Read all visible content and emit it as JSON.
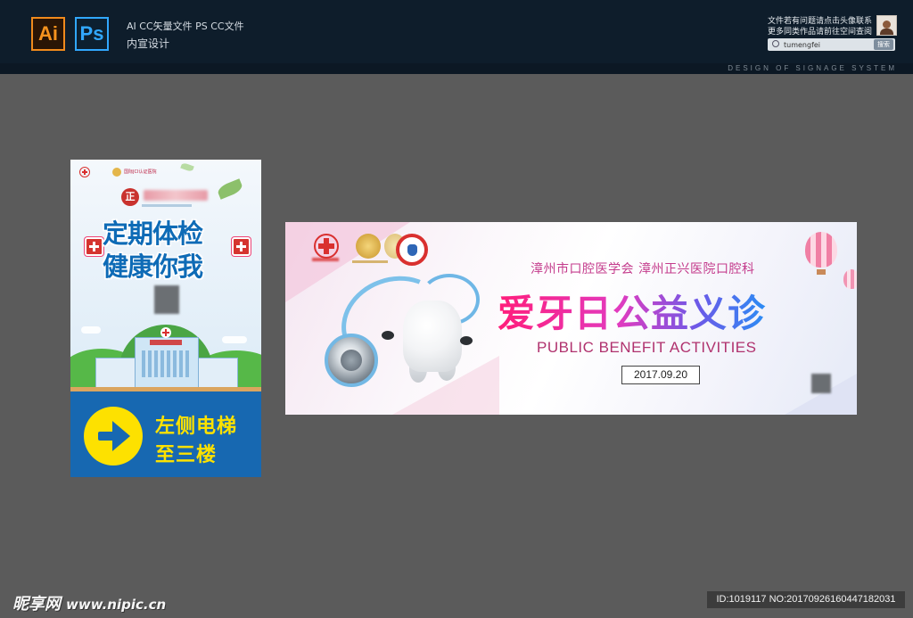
{
  "header": {
    "ai_icon_label": "Ai",
    "ps_icon_label": "Ps",
    "file_types": "AI CC矢量文件   PS CC文件",
    "category": "内宣设计",
    "contact_line1": "文件若有问题请点击头像联系",
    "contact_line2": "更多同类作品请前往空间查阅",
    "search_value": "tumengfei",
    "search_button": "搜索",
    "design_tag": "DESIGN OF SIGNAGE SYSTEM"
  },
  "poster": {
    "jci_label": "国际JCI认证医院",
    "emblem": "正",
    "title_line1": "定期体检",
    "title_line2": "健康你我",
    "direction_line1": "左侧电梯",
    "direction_line2": "至三楼"
  },
  "banner": {
    "subtitle": "漳州市口腔医学会   漳州正兴医院口腔科",
    "title": "爱牙日公益义诊",
    "english_title": "PUBLIC BENEFIT ACTIVITIES",
    "date": "2017.09.20"
  },
  "footer": {
    "watermark_name": "昵享网",
    "watermark_url": "www.nipic.cn",
    "image_id": "ID:1019117 NO:20170926160447182031"
  },
  "colors": {
    "header_bg": "#0e1d2b",
    "canvas_bg": "#5b5b5b",
    "ai_orange": "#f7931e",
    "ps_blue": "#31a8ff",
    "poster_blue": "#1768b1",
    "poster_yellow": "#fde100",
    "banner_pink": "#ff1d7a",
    "banner_blue": "#2b8cf4"
  }
}
